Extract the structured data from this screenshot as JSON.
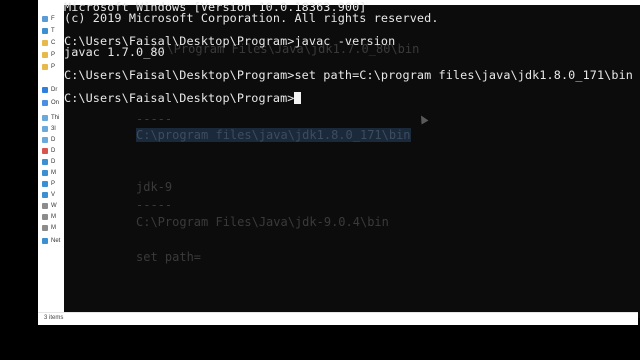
{
  "explorer": {
    "status_items": "3 items",
    "nav_items": [
      "F",
      "T",
      "C",
      "P",
      "P",
      "Dr",
      "On",
      "Thi",
      "3l",
      "D",
      "D",
      "D",
      "M",
      "P",
      "V",
      "W",
      "M",
      "M",
      "Net"
    ]
  },
  "console": {
    "lines": [
      "Microsoft Windows [Version 10.0.18363.900]",
      "(c) 2019 Microsoft Corporation. All rights reserved.",
      "",
      "C:\\Users\\Faisal\\Desktop\\Program>javac -version",
      "javac 1.7.0_80",
      "",
      "C:\\Users\\Faisal\\Desktop\\Program>set path=C:\\program files\\java\\jdk1.8.0_171\\bin",
      "",
      "C:\\Users\\Faisal\\Desktop\\Program>"
    ]
  },
  "background_notes": {
    "top_partial": "C:\\Program Files\\Java\\jdk1.7.0_80\\bin",
    "dash1": "-----",
    "jdk8_path": "C:\\program files\\java\\jdk1.8.0_171\\bin",
    "jdk9_heading": "jdk-9",
    "dash2": "-----",
    "jdk9_path": "C:\\Program Files\\Java\\jdk-9.0.4\\bin",
    "set_path": "set path="
  },
  "colors": {
    "console_bg": "#0c0c0c",
    "console_text": "#e8e8e8",
    "explorer_bg": "#ffffff"
  }
}
